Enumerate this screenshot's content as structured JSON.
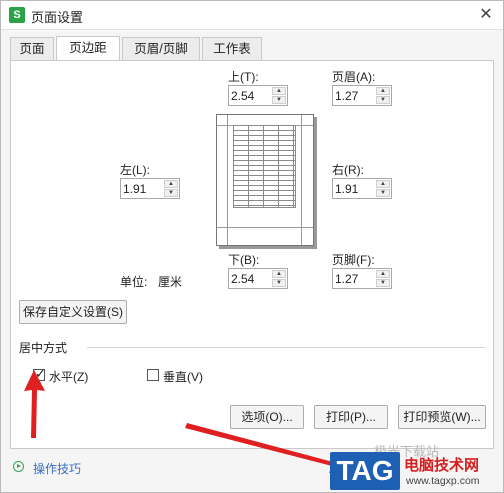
{
  "window": {
    "title": "页面设置",
    "app_icon": "wps-s-icon"
  },
  "tabs": [
    {
      "label": "页面"
    },
    {
      "label": "页边距"
    },
    {
      "label": "页眉/页脚"
    },
    {
      "label": "工作表"
    }
  ],
  "margins": {
    "top": {
      "label": "上(T):",
      "value": "2.54"
    },
    "bottom": {
      "label": "下(B):",
      "value": "2.54"
    },
    "left": {
      "label": "左(L):",
      "value": "1.91"
    },
    "right": {
      "label": "右(R):",
      "value": "1.91"
    },
    "header": {
      "label": "页眉(A):",
      "value": "1.27"
    },
    "footer": {
      "label": "页脚(F):",
      "value": "1.27"
    }
  },
  "unit": {
    "label": "单位:",
    "value": "厘米"
  },
  "save_custom_button": "保存自定义设置(S)",
  "center_section": {
    "title": "居中方式",
    "horizontal": {
      "label": "水平(Z)",
      "checked": true
    },
    "vertical": {
      "label": "垂直(V)",
      "checked": false
    }
  },
  "buttons": {
    "options": "选项(O)...",
    "print": "打印(P)...",
    "print_preview": "打印预览(W)..."
  },
  "tips": {
    "label": "操作技巧"
  },
  "watermark": {
    "tag": "TAG",
    "site_name": "电脑技术网",
    "url": "www.tagxp.com",
    "faded_text": "极光下载站"
  },
  "colors": {
    "annotation_arrow": "#e02020",
    "tips_link": "#3a6fc4",
    "app_icon": "#2ba245",
    "tag_blue": "#1e60b3"
  }
}
